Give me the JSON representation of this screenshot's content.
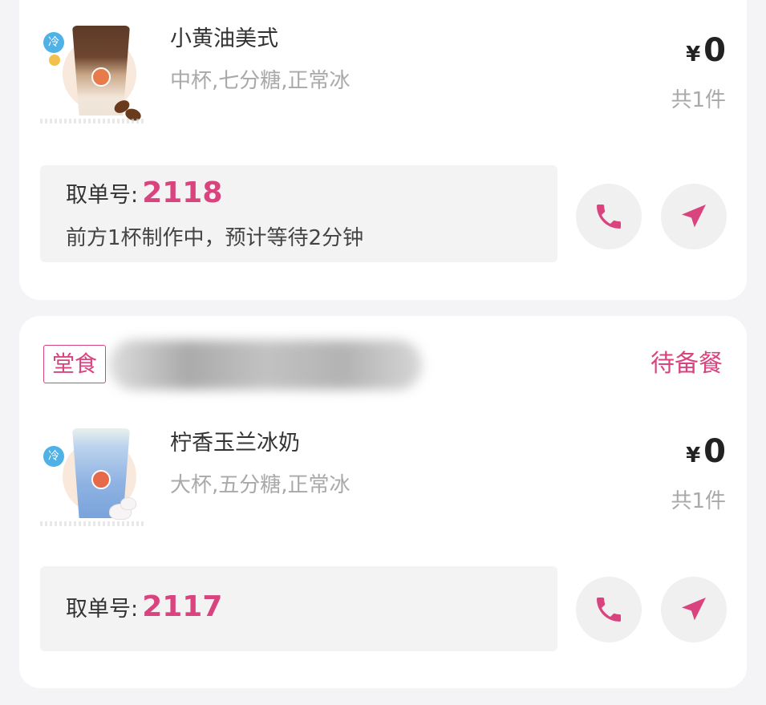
{
  "orders": [
    {
      "product_name": "小黄油美式",
      "spec": "中杯,七分糖,正常冰",
      "currency": "¥",
      "price": "0",
      "quantity": "共1件",
      "pickup_label": "取单号:",
      "pickup_number": "2118",
      "wait_text": "前方1杯制作中，预计等待2分钟",
      "temp_badge": "冷"
    },
    {
      "dine_tag": "堂食",
      "status": "待备餐",
      "product_name": "柠香玉兰冰奶",
      "spec": "大杯,五分糖,正常冰",
      "currency": "¥",
      "price": "0",
      "quantity": "共1件",
      "pickup_label": "取单号:",
      "pickup_number": "2117",
      "temp_badge": "冷"
    }
  ],
  "icons": {
    "phone": "phone-icon",
    "navigate": "navigation-arrow-icon"
  },
  "colors": {
    "accent": "#d9447f",
    "card_bg": "#ffffff",
    "page_bg": "#f4f4f6",
    "pickup_box_bg": "#f3f3f3"
  }
}
